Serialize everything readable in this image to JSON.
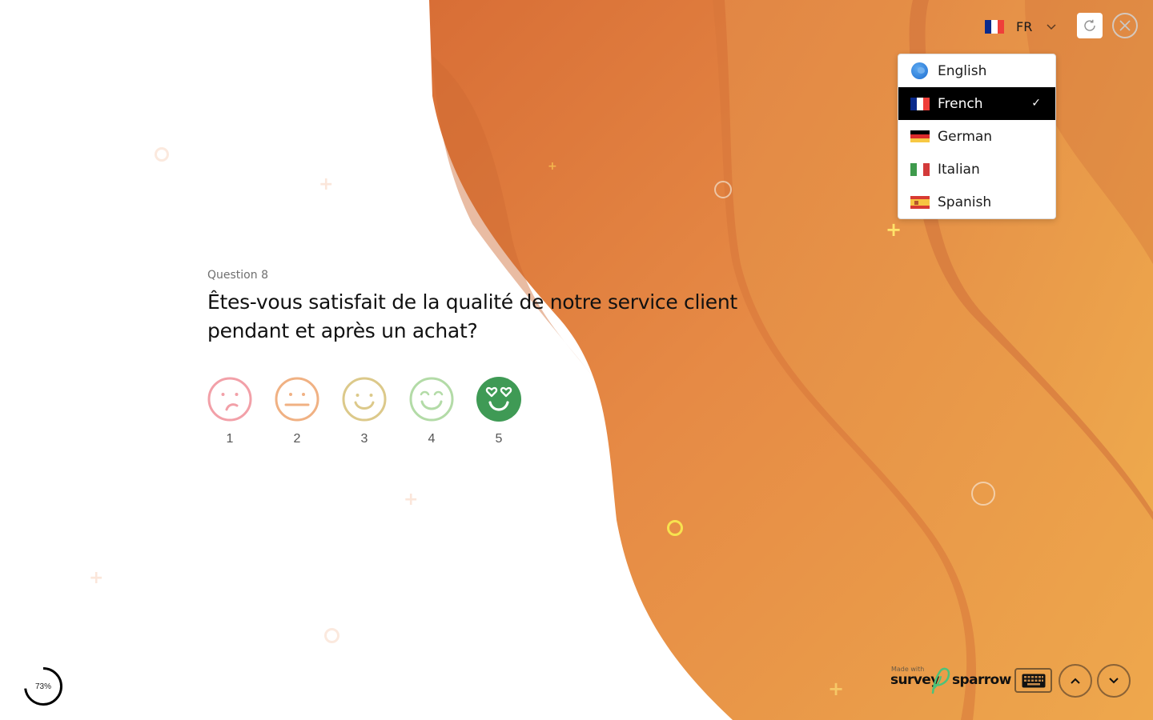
{
  "header": {
    "language_toggle": {
      "code": "FR",
      "flag": "fr"
    },
    "refresh_icon": "refresh-icon",
    "close_icon": "close-icon"
  },
  "language_menu": {
    "selected": "French",
    "items": [
      {
        "label": "English",
        "icon": "globe-icon",
        "selected": false
      },
      {
        "label": "French",
        "icon": "flag-fr-icon",
        "selected": true
      },
      {
        "label": "German",
        "icon": "flag-de-icon",
        "selected": false
      },
      {
        "label": "Italian",
        "icon": "flag-it-icon",
        "selected": false
      },
      {
        "label": "Spanish",
        "icon": "flag-es-icon",
        "selected": false
      }
    ],
    "check_glyph": "✓"
  },
  "question": {
    "number_label": "Question 8",
    "title": "Êtes-vous satisfait de la qualité de notre service client pendant et après un achat?",
    "rating": {
      "type": "smiley",
      "selected_value": 5,
      "options": [
        {
          "value": "1",
          "face": "sad-face-icon",
          "color": "#f2a0a8"
        },
        {
          "value": "2",
          "face": "neutral-face-icon",
          "color": "#f0b183"
        },
        {
          "value": "3",
          "face": "smile-face-icon",
          "color": "#dcc98a"
        },
        {
          "value": "4",
          "face": "grin-face-icon",
          "color": "#b3dba7"
        },
        {
          "value": "5",
          "face": "heart-eyes-face-icon",
          "color": "#3f9a55"
        }
      ]
    }
  },
  "footer": {
    "progress_percent": 73,
    "progress_label": "73%",
    "brand": {
      "made_with": "Made with",
      "name_part1": "survey",
      "name_part2": "sparrow"
    },
    "keyboard_icon": "keyboard-icon",
    "prev_icon": "chevron-up-icon",
    "next_icon": "chevron-down-icon"
  },
  "theme": {
    "accent_dark": "#d4703a",
    "accent_mid": "#e58b44",
    "accent_light": "#eeaa4c",
    "selected_bg": "#000000"
  }
}
